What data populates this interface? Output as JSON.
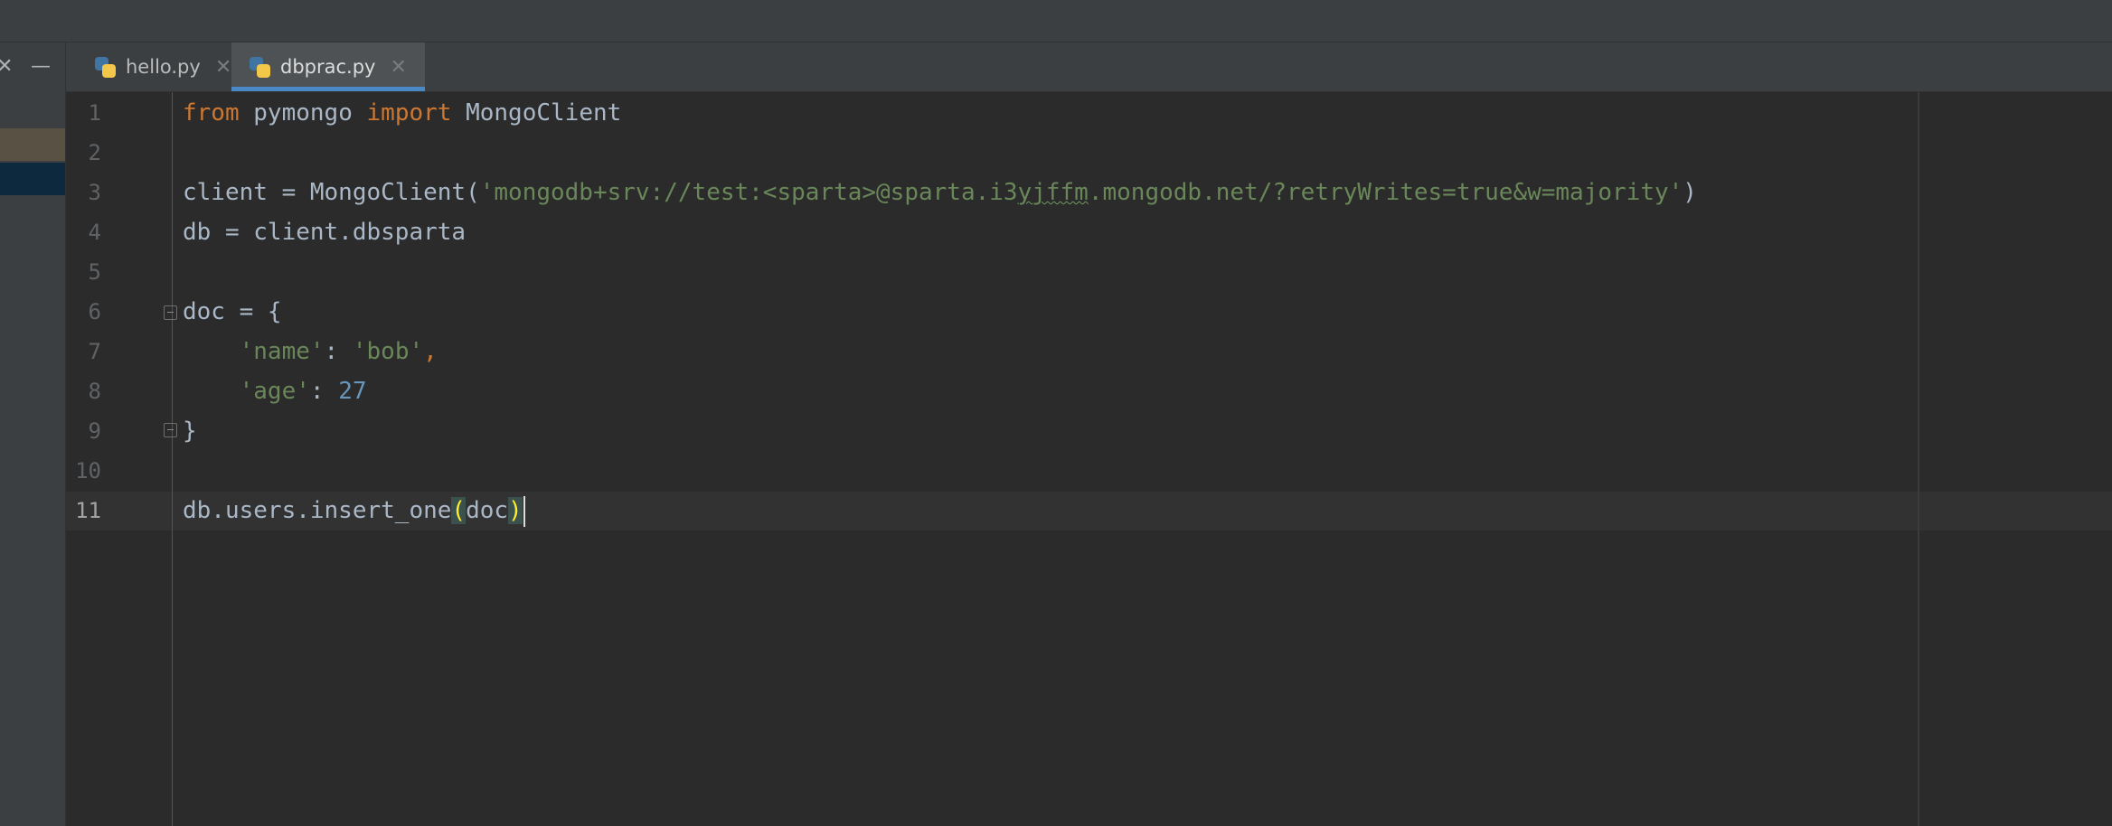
{
  "tabs": [
    {
      "label": "hello.py",
      "active": false,
      "icon": "python-file-icon"
    },
    {
      "label": "dbprac.py",
      "active": true,
      "icon": "python-file-icon"
    }
  ],
  "sidebar": {
    "icon_left": "✕",
    "icon_right": "—"
  },
  "editor": {
    "line_numbers": [
      "1",
      "2",
      "3",
      "4",
      "5",
      "6",
      "7",
      "8",
      "9",
      "10",
      "11"
    ],
    "current_line": "11",
    "lines": {
      "l1": {
        "kw1": "from",
        "mod": " pymongo ",
        "kw2": "import",
        "cls": " MongoClient"
      },
      "l3": {
        "pre": "client = MongoClient(",
        "str_pre": "'mongodb+srv://test:<sparta>@sparta.i3",
        "str_squig": "yjffm",
        "str_post": ".mongodb.net/?retryWrites=true&w=majority'",
        "post": ")"
      },
      "l4": {
        "text": "db = client.dbsparta"
      },
      "l6": {
        "text": "doc = {"
      },
      "l7": {
        "indent": "    ",
        "key": "'name'",
        "colon": ": ",
        "val": "'bob'",
        "comma": ","
      },
      "l8": {
        "indent": "    ",
        "key": "'age'",
        "colon": ": ",
        "val": "27"
      },
      "l9": {
        "text": "}"
      },
      "l11": {
        "pre": "db.users.insert_one",
        "open": "(",
        "arg": "doc",
        "close": ")"
      }
    }
  },
  "colors": {
    "keyword": "#cc7832",
    "string": "#6a8759",
    "number": "#6897bb",
    "text": "#a9b7c6",
    "accent": "#4a88c7"
  }
}
